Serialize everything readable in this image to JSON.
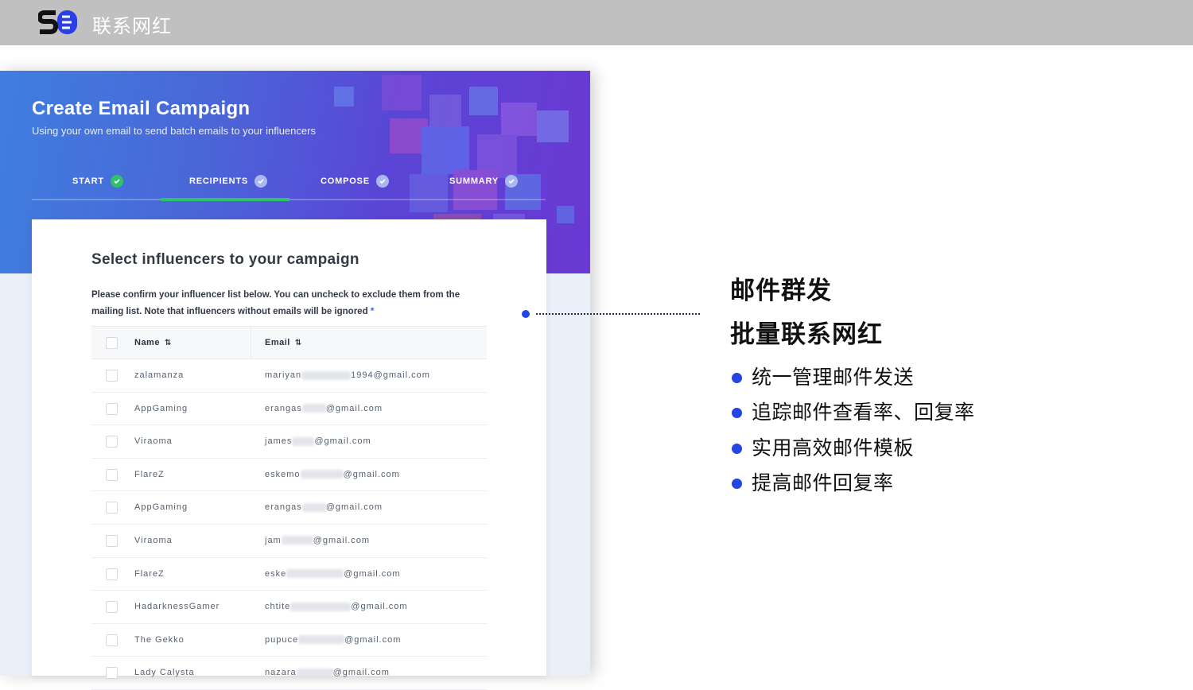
{
  "topbar": {
    "title": "联系网红",
    "logo": "SB-logo"
  },
  "campaign": {
    "title": "Create Email Campaign",
    "subtitle": "Using your own email to send batch emails to your influencers",
    "steps": [
      {
        "label": "START",
        "state": "done"
      },
      {
        "label": "RECIPIENTS",
        "state": "active"
      },
      {
        "label": "COMPOSE",
        "state": "pending"
      },
      {
        "label": "SUMMARY",
        "state": "pending"
      }
    ]
  },
  "card": {
    "title": "Select influencers to your campaign",
    "description": "Please confirm your influencer list below. You can uncheck to exclude them from the mailing list. Note that influencers without emails will be ignored",
    "required_mark": "*",
    "columns": {
      "name": "Name",
      "email": "Email"
    },
    "rows": [
      {
        "name": "zalamanza",
        "email_prefix": "mariyan",
        "email_suffix": "1994@gmail.com"
      },
      {
        "name": "AppGaming",
        "email_prefix": "erangas",
        "email_suffix": "@gmail.com"
      },
      {
        "name": "Viraoma",
        "email_prefix": "james",
        "email_suffix": "@gmail.com"
      },
      {
        "name": "FlareZ",
        "email_prefix": "eskemo",
        "email_suffix": "@gmail.com"
      },
      {
        "name": "AppGaming",
        "email_prefix": "erangas",
        "email_suffix": "@gmail.com"
      },
      {
        "name": "Viraoma",
        "email_prefix": "jam",
        "email_suffix": "@gmail.com"
      },
      {
        "name": "FlareZ",
        "email_prefix": "eske",
        "email_suffix": "@gmail.com"
      },
      {
        "name": "HadarknessGamer",
        "email_prefix": "chtite",
        "email_suffix": "@gmail.com"
      },
      {
        "name": "The Gekko",
        "email_prefix": "pupuce",
        "email_suffix": "@gmail.com"
      },
      {
        "name": "Lady Calysta",
        "email_prefix": "nazara",
        "email_suffix": "@gmail.com"
      }
    ]
  },
  "features": {
    "headline_1": "邮件群发",
    "headline_2": "批量联系网红",
    "bullets": [
      "统一管理邮件发送",
      "追踪邮件查看率、回复率",
      "实用高效邮件模板",
      "提高邮件回复率"
    ]
  },
  "colors": {
    "accent": "#2445e0",
    "success": "#2ec26a",
    "topbar": "#c0c0c0"
  }
}
